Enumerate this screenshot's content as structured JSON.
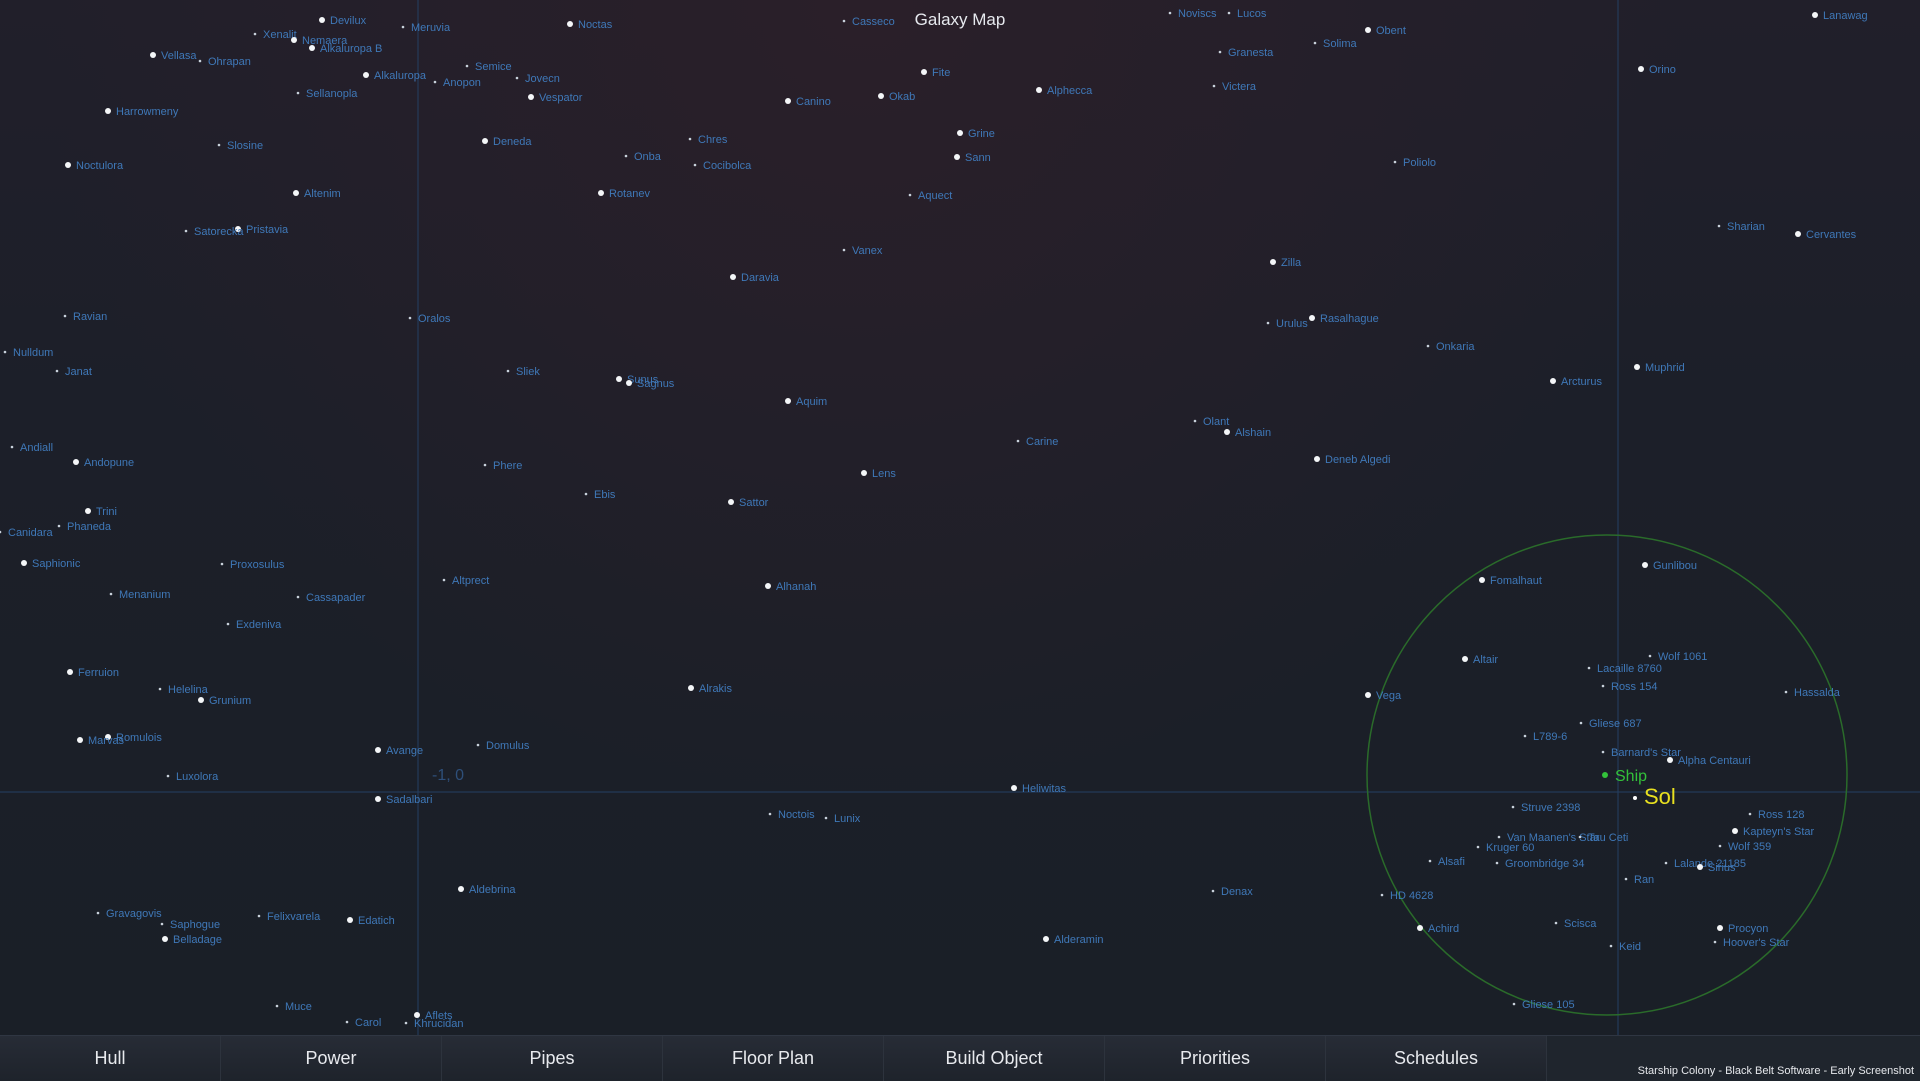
{
  "title": "Galaxy Map",
  "coordinate_label": "-1, 0",
  "ship_label": "Ship",
  "home_label": "Sol",
  "footer_credit": "Starship Colony - Black Belt Software - Early Screenshot",
  "colors": {
    "ship": "#33c23a",
    "home": "#e8e020",
    "range_ring": "#2a6b2a",
    "star_label": "#3f78b8",
    "grid": "#27456b"
  },
  "toolbar": {
    "tabs": [
      "Hull",
      "Power",
      "Pipes",
      "Floor Plan",
      "Build Object",
      "Priorities",
      "Schedules"
    ]
  },
  "stars": [
    {
      "name": "Devilux",
      "big": true
    },
    {
      "name": "Meruvia",
      "big": false
    },
    {
      "name": "Noctas",
      "big": true
    },
    {
      "name": "Casseco",
      "big": false
    },
    {
      "name": "Lucos",
      "big": false
    },
    {
      "name": "Noviscs",
      "big": false
    },
    {
      "name": "Obent",
      "big": true
    },
    {
      "name": "Lanawag",
      "big": true
    },
    {
      "name": "Xenalit",
      "big": false
    },
    {
      "name": "Nemaera",
      "big": true
    },
    {
      "name": "Alkaluropa B",
      "big": true
    },
    {
      "name": "Vellasa",
      "big": true
    },
    {
      "name": "Ohrapan",
      "big": false
    },
    {
      "name": "Semice",
      "big": false
    },
    {
      "name": "Solima",
      "big": false
    },
    {
      "name": "Granesta",
      "big": false
    },
    {
      "name": "Orino",
      "big": true
    },
    {
      "name": "Alkaluropa",
      "big": true
    },
    {
      "name": "Anopon",
      "big": false
    },
    {
      "name": "Jovecn",
      "big": false
    },
    {
      "name": "Fite",
      "big": true
    },
    {
      "name": "Alphecca",
      "big": true
    },
    {
      "name": "Victera",
      "big": false
    },
    {
      "name": "Sellanopla",
      "big": false
    },
    {
      "name": "Vespator",
      "big": true
    },
    {
      "name": "Okab",
      "big": true
    },
    {
      "name": "Canino",
      "big": true
    },
    {
      "name": "Harrowmeny",
      "big": true
    },
    {
      "name": "Grine",
      "big": true
    },
    {
      "name": "Deneda",
      "big": true
    },
    {
      "name": "Slosine",
      "big": false
    },
    {
      "name": "Chres",
      "big": false
    },
    {
      "name": "Sann",
      "big": true
    },
    {
      "name": "Noctulora",
      "big": true
    },
    {
      "name": "Onba",
      "big": false
    },
    {
      "name": "Cocibolca",
      "big": false
    },
    {
      "name": "Poliolo",
      "big": false
    },
    {
      "name": "Altenim",
      "big": true
    },
    {
      "name": "Rotanev",
      "big": true
    },
    {
      "name": "Aquect",
      "big": false
    },
    {
      "name": "Pristavia",
      "big": true
    },
    {
      "name": "Satorecka",
      "big": false
    },
    {
      "name": "Sharian",
      "big": false
    },
    {
      "name": "Cervantes",
      "big": true
    },
    {
      "name": "Vanex",
      "big": false
    },
    {
      "name": "Zilla",
      "big": true
    },
    {
      "name": "Daravia",
      "big": true
    },
    {
      "name": "Ravian",
      "big": false
    },
    {
      "name": "Oralos",
      "big": false
    },
    {
      "name": "Urulus",
      "big": false
    },
    {
      "name": "Rasalhague",
      "big": true
    },
    {
      "name": "Onkaria",
      "big": false
    },
    {
      "name": "Nulldum",
      "big": false
    },
    {
      "name": "Arcturus",
      "big": true
    },
    {
      "name": "Muphrid",
      "big": true
    },
    {
      "name": "Janat",
      "big": false
    },
    {
      "name": "Sliek",
      "big": false
    },
    {
      "name": "Sunus",
      "big": true
    },
    {
      "name": "Sagnus",
      "big": true
    },
    {
      "name": "Aquim",
      "big": true
    },
    {
      "name": "Olant",
      "big": false
    },
    {
      "name": "Alshain",
      "big": true
    },
    {
      "name": "Carine",
      "big": false
    },
    {
      "name": "Andiall",
      "big": false
    },
    {
      "name": "Andopune",
      "big": true
    },
    {
      "name": "Phere",
      "big": false
    },
    {
      "name": "Deneb Algedi",
      "big": true
    },
    {
      "name": "Lens",
      "big": true
    },
    {
      "name": "Ebis",
      "big": false
    },
    {
      "name": "Sattor",
      "big": true
    },
    {
      "name": "Trini",
      "big": true
    },
    {
      "name": "Phaneda",
      "big": false
    },
    {
      "name": "Canidara",
      "big": false
    },
    {
      "name": "Saphionic",
      "big": true
    },
    {
      "name": "Proxosulus",
      "big": false
    },
    {
      "name": "Altprect",
      "big": false
    },
    {
      "name": "Gunlibou",
      "big": true
    },
    {
      "name": "Fomalhaut",
      "big": true
    },
    {
      "name": "Alhanah",
      "big": true
    },
    {
      "name": "Menanium",
      "big": false
    },
    {
      "name": "Cassapader",
      "big": false
    },
    {
      "name": "Exdeniva",
      "big": false
    },
    {
      "name": "Wolf 1061",
      "big": false
    },
    {
      "name": "Altair",
      "big": true
    },
    {
      "name": "Lacaille 8760",
      "big": false
    },
    {
      "name": "Ferruion",
      "big": true
    },
    {
      "name": "Ross 154",
      "big": false
    },
    {
      "name": "Helelina",
      "big": false
    },
    {
      "name": "Vega",
      "big": true
    },
    {
      "name": "Alrakis",
      "big": true
    },
    {
      "name": "Hassalda",
      "big": false
    },
    {
      "name": "Grunium",
      "big": true
    },
    {
      "name": "Gliese 687",
      "big": false
    },
    {
      "name": "L789-6",
      "big": false
    },
    {
      "name": "Romulois",
      "big": true
    },
    {
      "name": "Marvas",
      "big": true
    },
    {
      "name": "Domulus",
      "big": false
    },
    {
      "name": "Avange",
      "big": true
    },
    {
      "name": "Barnard's Star",
      "big": false
    },
    {
      "name": "Alpha Centauri",
      "big": true
    },
    {
      "name": "Luxolora",
      "big": false
    },
    {
      "name": "Sadalbari",
      "big": true
    },
    {
      "name": "Noctois",
      "big": false
    },
    {
      "name": "Lunix",
      "big": false
    },
    {
      "name": "Heliwitas",
      "big": true
    },
    {
      "name": "Struve 2398",
      "big": false
    },
    {
      "name": "Ross 128",
      "big": false
    },
    {
      "name": "Van Maanen's Star",
      "big": false
    },
    {
      "name": "Tau Ceti",
      "big": false
    },
    {
      "name": "Kapteyn's Star",
      "big": true
    },
    {
      "name": "Wolf 359",
      "big": false
    },
    {
      "name": "Kruger 60",
      "big": false
    },
    {
      "name": "Alsafi",
      "big": false
    },
    {
      "name": "Groombridge 34",
      "big": false
    },
    {
      "name": "Lalande 21185",
      "big": false
    },
    {
      "name": "Sirius",
      "big": true
    },
    {
      "name": "Ran",
      "big": false
    },
    {
      "name": "Aldebrina",
      "big": true
    },
    {
      "name": "Denax",
      "big": false
    },
    {
      "name": "HD 4628",
      "big": false
    },
    {
      "name": "Achird",
      "big": true
    },
    {
      "name": "Scisca",
      "big": false
    },
    {
      "name": "Procyon",
      "big": true
    },
    {
      "name": "Hoover's Star",
      "big": false
    },
    {
      "name": "Gravagovis",
      "big": false
    },
    {
      "name": "Felixvarela",
      "big": false
    },
    {
      "name": "Edatich",
      "big": true
    },
    {
      "name": "Saphogue",
      "big": false
    },
    {
      "name": "Belladage",
      "big": true
    },
    {
      "name": "Alderamin",
      "big": true
    },
    {
      "name": "Keid",
      "big": false
    },
    {
      "name": "Muce",
      "big": false
    },
    {
      "name": "Aflets",
      "big": true
    },
    {
      "name": "Carol",
      "big": false
    },
    {
      "name": "Khrucidan",
      "big": false
    },
    {
      "name": "Gliese 105",
      "big": false
    }
  ]
}
